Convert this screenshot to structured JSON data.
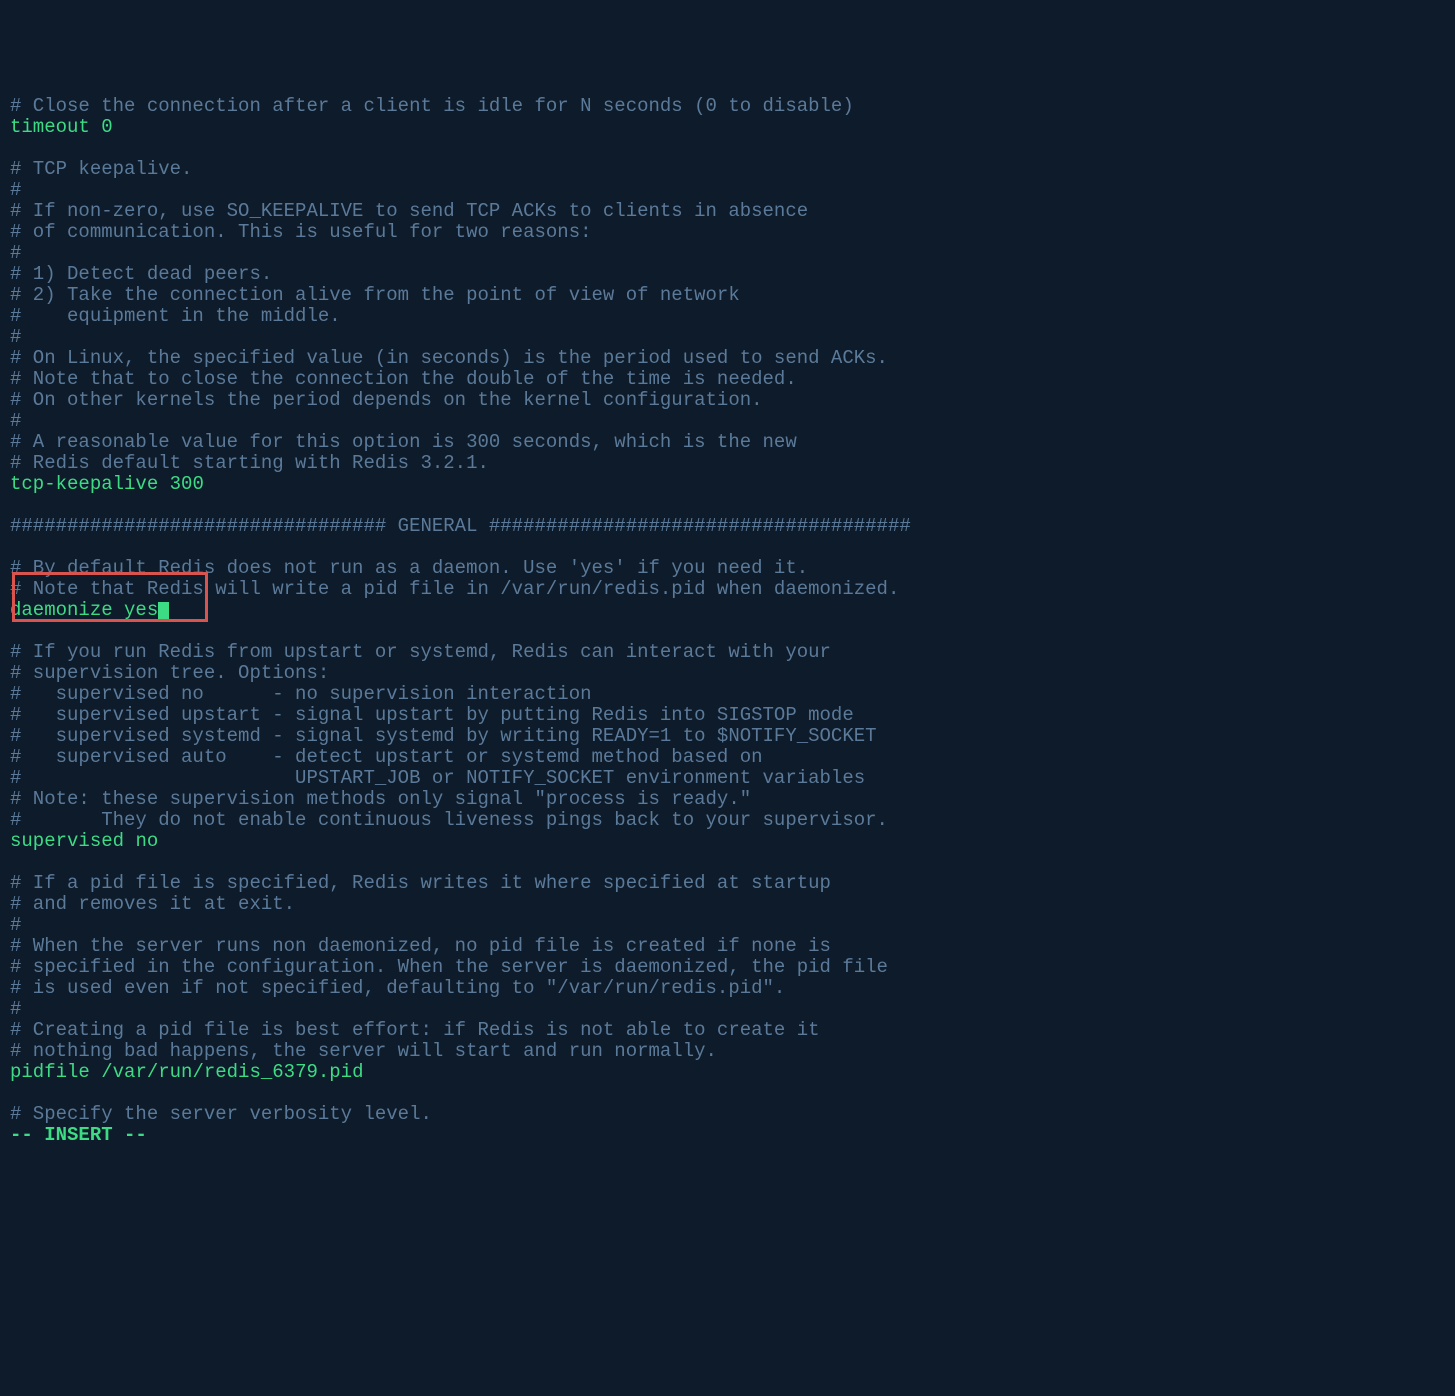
{
  "lines": [
    {
      "type": "comment",
      "text": "# Close the connection after a client is idle for N seconds (0 to disable)"
    },
    {
      "type": "config",
      "keyword": "timeout",
      "value": "0"
    },
    {
      "type": "blank",
      "text": ""
    },
    {
      "type": "comment",
      "text": "# TCP keepalive."
    },
    {
      "type": "comment",
      "text": "#"
    },
    {
      "type": "comment",
      "text": "# If non-zero, use SO_KEEPALIVE to send TCP ACKs to clients in absence"
    },
    {
      "type": "comment",
      "text": "# of communication. This is useful for two reasons:"
    },
    {
      "type": "comment",
      "text": "#"
    },
    {
      "type": "comment",
      "text": "# 1) Detect dead peers."
    },
    {
      "type": "comment",
      "text": "# 2) Take the connection alive from the point of view of network"
    },
    {
      "type": "comment",
      "text": "#    equipment in the middle."
    },
    {
      "type": "comment",
      "text": "#"
    },
    {
      "type": "comment",
      "text": "# On Linux, the specified value (in seconds) is the period used to send ACKs."
    },
    {
      "type": "comment",
      "text": "# Note that to close the connection the double of the time is needed."
    },
    {
      "type": "comment",
      "text": "# On other kernels the period depends on the kernel configuration."
    },
    {
      "type": "comment",
      "text": "#"
    },
    {
      "type": "comment",
      "text": "# A reasonable value for this option is 300 seconds, which is the new"
    },
    {
      "type": "comment",
      "text": "# Redis default starting with Redis 3.2.1."
    },
    {
      "type": "config",
      "keyword": "tcp-keepalive",
      "value": "300"
    },
    {
      "type": "blank",
      "text": ""
    },
    {
      "type": "comment",
      "text": "################################# GENERAL #####################################"
    },
    {
      "type": "blank",
      "text": ""
    },
    {
      "type": "comment",
      "text": "# By default Redis does not run as a daemon. Use 'yes' if you need it."
    },
    {
      "type": "comment",
      "text": "# Note that Redis will write a pid file in /var/run/redis.pid when daemonized."
    },
    {
      "type": "config-cursor",
      "keyword": "daemonize",
      "value": "yes",
      "cursor": true,
      "highlighted": true
    },
    {
      "type": "blank",
      "text": ""
    },
    {
      "type": "comment",
      "text": "# If you run Redis from upstart or systemd, Redis can interact with your"
    },
    {
      "type": "comment",
      "text": "# supervision tree. Options:"
    },
    {
      "type": "comment",
      "text": "#   supervised no      - no supervision interaction"
    },
    {
      "type": "comment",
      "text": "#   supervised upstart - signal upstart by putting Redis into SIGSTOP mode"
    },
    {
      "type": "comment",
      "text": "#   supervised systemd - signal systemd by writing READY=1 to $NOTIFY_SOCKET"
    },
    {
      "type": "comment",
      "text": "#   supervised auto    - detect upstart or systemd method based on"
    },
    {
      "type": "comment",
      "text": "#                        UPSTART_JOB or NOTIFY_SOCKET environment variables"
    },
    {
      "type": "comment",
      "text": "# Note: these supervision methods only signal \"process is ready.\""
    },
    {
      "type": "comment",
      "text": "#       They do not enable continuous liveness pings back to your supervisor."
    },
    {
      "type": "config",
      "keyword": "supervised",
      "value": "no"
    },
    {
      "type": "blank",
      "text": ""
    },
    {
      "type": "comment",
      "text": "# If a pid file is specified, Redis writes it where specified at startup"
    },
    {
      "type": "comment",
      "text": "# and removes it at exit."
    },
    {
      "type": "comment",
      "text": "#"
    },
    {
      "type": "comment",
      "text": "# When the server runs non daemonized, no pid file is created if none is"
    },
    {
      "type": "comment",
      "text": "# specified in the configuration. When the server is daemonized, the pid file"
    },
    {
      "type": "comment",
      "text": "# is used even if not specified, defaulting to \"/var/run/redis.pid\"."
    },
    {
      "type": "comment",
      "text": "#"
    },
    {
      "type": "comment",
      "text": "# Creating a pid file is best effort: if Redis is not able to create it"
    },
    {
      "type": "comment",
      "text": "# nothing bad happens, the server will start and run normally."
    },
    {
      "type": "config",
      "keyword": "pidfile",
      "value": "/var/run/redis_6379.pid"
    },
    {
      "type": "blank",
      "text": ""
    },
    {
      "type": "comment",
      "text": "# Specify the server verbosity level."
    }
  ],
  "status": {
    "mode": "-- INSERT --"
  },
  "highlight": {
    "line_index": 24
  }
}
